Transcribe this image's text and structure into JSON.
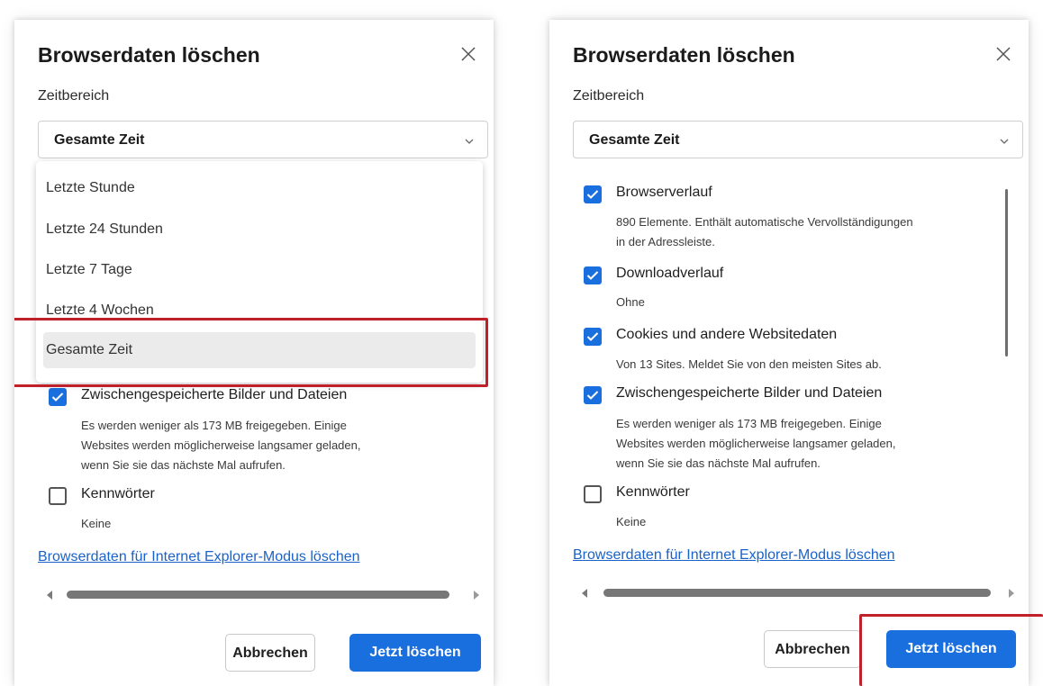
{
  "dialog": {
    "title": "Browserdaten löschen",
    "time_range_label": "Zeitbereich",
    "time_range_value": "Gesamte Zeit",
    "time_range_options": [
      "Letzte Stunde",
      "Letzte 24 Stunden",
      "Letzte 7 Tage",
      "Letzte 4 Wochen",
      "Gesamte Zeit"
    ],
    "items": [
      {
        "label": "Browserverlauf",
        "checked": true,
        "desc": [
          "890 Elemente. Enthält automatische Vervollständigungen",
          "in der Adressleiste."
        ]
      },
      {
        "label": "Downloadverlauf",
        "checked": true,
        "desc": [
          "Ohne"
        ]
      },
      {
        "label": "Cookies und andere Websitedaten",
        "checked": true,
        "desc": [
          "Von 13 Sites. Meldet Sie von den meisten Sites ab."
        ]
      },
      {
        "label": "Zwischengespeicherte Bilder und Dateien",
        "checked": true,
        "desc": [
          "Es werden weniger als 173 MB freigegeben. Einige",
          "Websites werden möglicherweise langsamer geladen,",
          "wenn Sie sie das nächste Mal aufrufen."
        ]
      },
      {
        "label": "Kennwörter",
        "checked": false,
        "desc": [
          "Keine"
        ]
      }
    ],
    "ie_link": "Browserdaten für Internet Explorer-Modus löschen",
    "cancel_label": "Abbrechen",
    "confirm_label": "Jetzt löschen"
  },
  "colors": {
    "accent": "#1a6fde",
    "highlight_border": "#c0202a",
    "link": "#1a62c8"
  },
  "icons": {
    "close": "close-icon",
    "chevron": "chevron-down-icon",
    "checkmark": "checkmark-icon"
  }
}
